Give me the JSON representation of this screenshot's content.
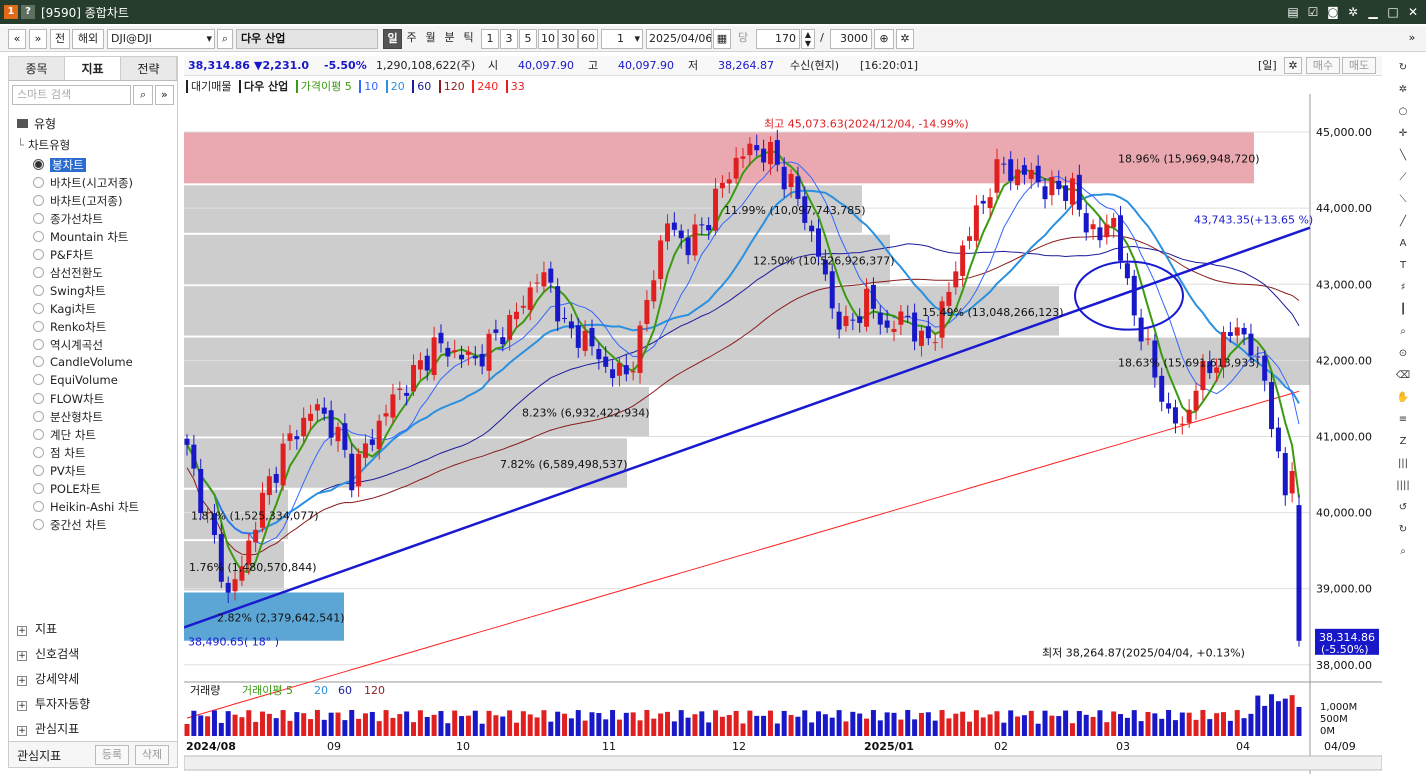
{
  "window": {
    "badge1": "1",
    "badge2": "?",
    "title": "[9590] 종합차트"
  },
  "toolbar": {
    "prev": "«",
    "down": "»",
    "b_jeon": "전",
    "b_haeoe": "해외",
    "symbol": "DJI@DJI",
    "name": "다우 산업",
    "periods": [
      "일",
      "주",
      "월",
      "분",
      "틱"
    ],
    "intervals": [
      "1",
      "3",
      "5",
      "10",
      "30",
      "60"
    ],
    "mult": "1",
    "date": "2025/04/06",
    "dang": "당",
    "count": "170",
    "slash": "/",
    "total": "3000"
  },
  "left": {
    "tabs": [
      "종목",
      "지표",
      "전략"
    ],
    "search_placeholder": "스마트 검색",
    "group": "유형",
    "subgroup": "차트유형",
    "items": [
      "봉차트",
      "바차트(시고저종)",
      "바차트(고저종)",
      "종가선차트",
      "Mountain 차트",
      "P&F차트",
      "삼선전환도",
      "Swing차트",
      "Kagi차트",
      "Renko차트",
      "역시계곡선",
      "CandleVolume",
      "EquiVolume",
      "FLOW차트",
      "분산형차트",
      "계단 차트",
      "점 차트",
      "PV차트",
      "POLE차트",
      "Heikin-Ashi 차트",
      "중간선 차트"
    ],
    "sections": [
      "지표",
      "신호검색",
      "강세약세",
      "투자자동향",
      "관심지표"
    ],
    "footer_label": "관심지표",
    "footer_btn1": "등록",
    "footer_btn2": "삭제"
  },
  "info": {
    "price": "38,314.86",
    "change": "▼2,231.0",
    "pct": "-5.50%",
    "volume": "1,290,108,622(주)",
    "open_label": "시",
    "open": "40,097.90",
    "high_label": "고",
    "high": "40,097.90",
    "low_label": "저",
    "low": "38,264.87",
    "recv": "수신(현지)",
    "time": "[16:20:01]",
    "period": "[일]",
    "buy": "매수",
    "sell": "매도"
  },
  "legend": {
    "main": "대기매물",
    "name": "다우 산업",
    "ma_label": "가격이평 5",
    "ma": [
      "10",
      "20",
      "60",
      "120",
      "240",
      "33"
    ]
  },
  "volume_legend": {
    "main": "거래량",
    "ma_label": "거래이평 5",
    "ma": [
      "20",
      "60",
      "120"
    ]
  },
  "annotations": {
    "high": "최고 45,073.63(2024/12/04, -14.99%)",
    "low": "최저 38,264.87(2025/04/04, +0.13%)",
    "trend": "43,743.35(+13.65 %)",
    "start": "38,490.65( 18° )",
    "last_price": "38,314.86",
    "last_pct": "(-5.50%)"
  },
  "colors": {
    "red": "#e02020",
    "blue": "#1818c8",
    "ma5": "#3a9a10",
    "ma10": "#3366ff",
    "ma20": "#2a90e0",
    "ma60": "#1c1c9c",
    "ma120": "#8a1c1c",
    "ma240": "#ff2020",
    "trend": "#1a1ad0",
    "hi_zone": "#e8a0a8",
    "zone": "#c8c8c8"
  },
  "chart_data": {
    "type": "candlestick",
    "y_ticks": [
      "45,000.00",
      "44,000.00",
      "43,000.00",
      "42,000.00",
      "41,000.00",
      "40,000.00",
      "39,000.00"
    ],
    "y_partial_tick": "38,000.00",
    "ylim": [
      37800,
      45500
    ],
    "x_labels": [
      "2024/08",
      "09",
      "10",
      "11",
      "12",
      "2025/01",
      "02",
      "03",
      "04"
    ],
    "x_right_label": "04/09",
    "vol_ticks": [
      "1,000M",
      "500M",
      "0M"
    ],
    "volume_profile": [
      {
        "lo": 44300,
        "hi": 45000,
        "label": "18.96% (15,969,948,720)",
        "top": true
      },
      {
        "lo": 43650,
        "hi": 44300,
        "label": "11.99% (10,097,743,785)"
      },
      {
        "lo": 42975,
        "hi": 43650,
        "label": "12.50% (10,526,926,377)"
      },
      {
        "lo": 42300,
        "hi": 42975,
        "label": "15.49% (13,048,266,123)"
      },
      {
        "lo": 41650,
        "hi": 42300,
        "label": "18.63% (15,691,613,933)"
      },
      {
        "lo": 40975,
        "hi": 41650,
        "label": "8.23% (6,932,422,934)"
      },
      {
        "lo": 40300,
        "hi": 40975,
        "label": "7.82% (6,589,498,537)"
      },
      {
        "lo": 39625,
        "hi": 40300,
        "label": "1.81% (1,525,334,077)"
      },
      {
        "lo": 38950,
        "hi": 39625,
        "label": "1.76% (1,480,570,844)"
      },
      {
        "lo": 38290,
        "hi": 38950,
        "label": "2.82% (2,379,642,541)",
        "low": true
      }
    ],
    "close_path": [
      [
        0,
        40800
      ],
      [
        4,
        39600
      ],
      [
        6,
        38900
      ],
      [
        8,
        39300
      ],
      [
        10,
        39900
      ],
      [
        12,
        40400
      ],
      [
        14,
        40800
      ],
      [
        16,
        41100
      ],
      [
        19,
        41400
      ],
      [
        22,
        41000
      ],
      [
        24,
        40500
      ],
      [
        27,
        41000
      ],
      [
        30,
        41500
      ],
      [
        33,
        41800
      ],
      [
        36,
        42200
      ],
      [
        39,
        42100
      ],
      [
        42,
        42000
      ],
      [
        45,
        42300
      ],
      [
        48,
        42600
      ],
      [
        51,
        43100
      ],
      [
        53,
        43000
      ],
      [
        55,
        42400
      ],
      [
        58,
        42300
      ],
      [
        61,
        41900
      ],
      [
        64,
        41800
      ],
      [
        66,
        42300
      ],
      [
        68,
        43200
      ],
      [
        70,
        43800
      ],
      [
        73,
        43500
      ],
      [
        76,
        43900
      ],
      [
        79,
        44500
      ],
      [
        82,
        44800
      ],
      [
        85,
        44700
      ],
      [
        88,
        44300
      ],
      [
        90,
        43900
      ],
      [
        92,
        43400
      ],
      [
        94,
        42700
      ],
      [
        96,
        42400
      ],
      [
        99,
        42800
      ],
      [
        102,
        42400
      ],
      [
        105,
        42600
      ],
      [
        107,
        42200
      ],
      [
        109,
        42400
      ],
      [
        111,
        42900
      ],
      [
        113,
        43500
      ],
      [
        115,
        43900
      ],
      [
        117,
        44300
      ],
      [
        119,
        44600
      ],
      [
        121,
        44400
      ],
      [
        123,
        44500
      ],
      [
        125,
        44200
      ],
      [
        127,
        44300
      ],
      [
        129,
        44200
      ],
      [
        131,
        43800
      ],
      [
        133,
        43600
      ],
      [
        135,
        43900
      ],
      [
        137,
        42900
      ],
      [
        139,
        42400
      ],
      [
        141,
        41800
      ],
      [
        143,
        41300
      ],
      [
        145,
        41100
      ],
      [
        147,
        41700
      ],
      [
        149,
        41900
      ],
      [
        151,
        42200
      ],
      [
        153,
        42500
      ],
      [
        155,
        42100
      ],
      [
        157,
        41800
      ],
      [
        159,
        40600
      ],
      [
        160,
        40300
      ],
      [
        162,
        38300
      ]
    ]
  }
}
